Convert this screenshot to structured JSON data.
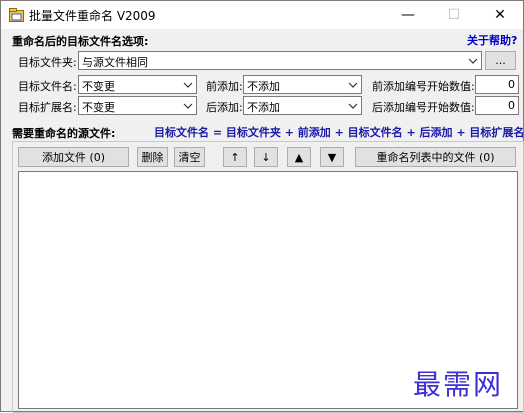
{
  "window": {
    "title": "批量文件重命名 V2009",
    "minimize_glyph": "—",
    "maximize_glyph": "☐",
    "close_glyph": "✕"
  },
  "target_section": {
    "title": "重命名后的目标文件名选项:",
    "help_link": "关于帮助?",
    "folder_label": "目标文件夹:",
    "folder_value": "与源文件相同",
    "browse_label": "...",
    "name_label": "目标文件名:",
    "name_value": "不变更",
    "ext_label": "目标扩展名:",
    "ext_value": "不变更",
    "prefix_label": "前添加:",
    "prefix_value": "不添加",
    "suffix_label": "后添加:",
    "suffix_value": "不添加",
    "prefix_num_label": "前添加编号开始数值:",
    "prefix_num_value": "0",
    "suffix_num_label": "后添加编号开始数值:",
    "suffix_num_value": "0"
  },
  "source_section": {
    "title": "需要重命名的源文件:",
    "formula": "目标文件名 = 目标文件夹 + 前添加 + 目标文件名 + 后添加 + 目标扩展名",
    "add_button": "添加文件 (0)",
    "delete_button": "删除",
    "clear_button": "清空",
    "up_button": "↑",
    "down_button": "↓",
    "top_button": "▲",
    "bottom_button": "▼",
    "rename_button": "重命名列表中的文件 (0)"
  },
  "watermark": "最需网",
  "colors": {
    "help_link": "#0000cc",
    "formula": "#1a1aa6",
    "watermark": "#3b2fd6"
  }
}
